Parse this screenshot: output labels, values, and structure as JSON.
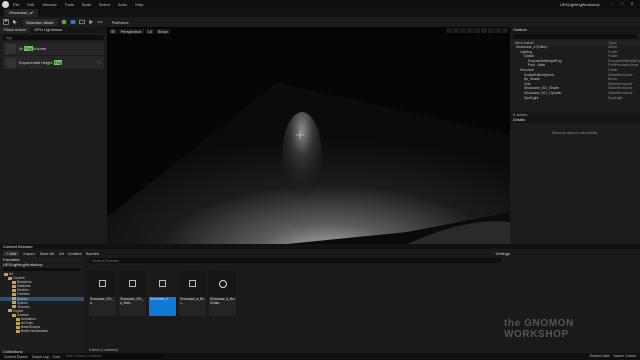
{
  "app": {
    "window_title": "UE5LightingWorkshop",
    "menu": [
      "File",
      "Edit",
      "Window",
      "Tools",
      "Build",
      "Select",
      "Actor",
      "Help"
    ],
    "level_tab": "Showcase_a*"
  },
  "toolbar": {
    "mode": "Selection Mode",
    "platforms": "Platforms"
  },
  "place_actors": {
    "tabs": [
      "Place Actors",
      "GPU Lightmass"
    ],
    "search_value": "fog",
    "items": [
      {
        "label": "Ar",
        "tag": "Fog",
        "suffix": "Volume"
      },
      {
        "label": "Exponential Height",
        "tag": "Fog",
        "suffix": ""
      }
    ]
  },
  "viewport": {
    "buttons": [
      "Perspective",
      "Lit",
      "Show"
    ]
  },
  "outliner": {
    "title": "Outliner",
    "columns": [
      "Item Label",
      "Type"
    ],
    "rows": [
      {
        "indent": 1,
        "label": "Showcase_a (Editor)",
        "type": "World",
        "sel": false
      },
      {
        "indent": 2,
        "label": "Lighting",
        "type": "Folder",
        "sel": false
      },
      {
        "indent": 3,
        "label": "Global",
        "type": "Folder",
        "sel": false
      },
      {
        "indent": 4,
        "label": "ExponentialHeightFog",
        "type": "ExponentialHeightFog",
        "sel": false
      },
      {
        "indent": 4,
        "label": "Post - Main",
        "type": "PostProcessVolume",
        "sel": false
      },
      {
        "indent": 2,
        "label": "Structure",
        "type": "Folder",
        "sel": false
      },
      {
        "indent": 3,
        "label": "ScaledEditorSphere",
        "type": "StaticMeshActor",
        "sel": false
      },
      {
        "indent": 3,
        "label": "Bp_Shade",
        "type": "Brush",
        "sel": false
      },
      {
        "indent": 3,
        "label": "Grid",
        "type": "StaticMeshActor",
        "sel": false
      },
      {
        "indent": 3,
        "label": "Showcase_001_Shade",
        "type": "StaticMeshActor",
        "sel": false
      },
      {
        "indent": 3,
        "label": "Showcase_001_Cylinder",
        "type": "StaticMeshActor",
        "sel": false
      },
      {
        "indent": 3,
        "label": "SpotLight",
        "type": "SpotLight",
        "sel": false
      }
    ],
    "footer": "9 actors"
  },
  "details": {
    "title": "Details",
    "message": "Select an object to view details."
  },
  "content_browser": {
    "tab": "Content Browser",
    "add": "Add",
    "import": "Import",
    "save_all": "Save All",
    "breadcrumbs": [
      "All",
      "Content",
      "Scenes"
    ],
    "settings": "Settings",
    "tree_headers": [
      "Favorites",
      "UE5LightingWorkshop"
    ],
    "tree": [
      {
        "indent": 1,
        "label": "All",
        "sel": false
      },
      {
        "indent": 2,
        "label": "Content",
        "sel": false
      },
      {
        "indent": 3,
        "label": "Blueprints",
        "sel": false
      },
      {
        "indent": 3,
        "label": "Materials",
        "sel": false
      },
      {
        "indent": 3,
        "label": "Meshes",
        "sel": false
      },
      {
        "indent": 3,
        "label": "Particles",
        "sel": false
      },
      {
        "indent": 3,
        "label": "Scenes",
        "sel": true
      },
      {
        "indent": 3,
        "label": "Splines",
        "sel": false
      },
      {
        "indent": 3,
        "label": "Textures",
        "sel": false
      },
      {
        "indent": 2,
        "label": "Engine",
        "sel": false
      },
      {
        "indent": 3,
        "label": "Content",
        "sel": false
      },
      {
        "indent": 4,
        "label": "Animation",
        "sel": false
      },
      {
        "indent": 4,
        "label": "ArtTools",
        "sel": false
      },
      {
        "indent": 4,
        "label": "BasicShapes",
        "sel": false
      },
      {
        "indent": 4,
        "label": "BufferVisualization",
        "sel": false
      }
    ],
    "search_placeholder": "Search Scenes",
    "assets": [
      {
        "name": "Showcase_001_a",
        "sel": false
      },
      {
        "name": "Showcase_001_a_Built...",
        "sel": false
      },
      {
        "name": "Showcase_a",
        "sel": true
      },
      {
        "name": "Showcase_a_Bui...",
        "sel": false
      },
      {
        "name": "Showcase_a_Built Data",
        "sel": false
      }
    ],
    "count": "5 items (1 selected)",
    "collections": "Collections"
  },
  "statusbar": {
    "left": [
      "Content Drawer",
      "Output Log",
      "Cmd"
    ],
    "cmd_placeholder": "Enter Console Command",
    "right": [
      "Derived Data",
      "Source Control"
    ]
  },
  "watermark": "the GNOMON WORKSHOP"
}
